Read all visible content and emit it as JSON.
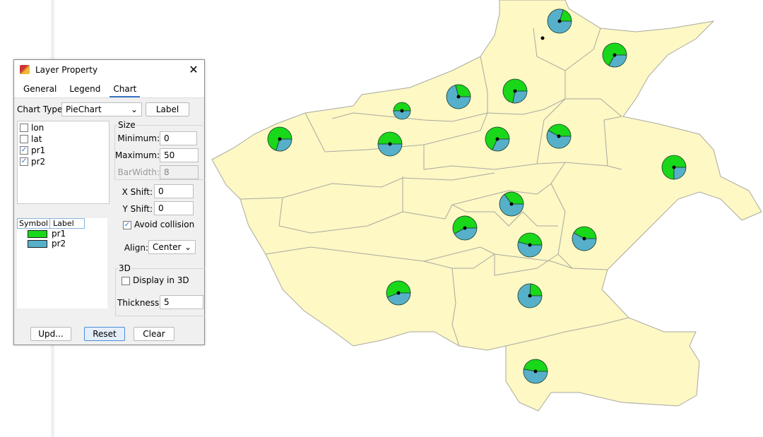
{
  "dialog": {
    "title": "Layer Property",
    "close_icon": "close-icon",
    "tabs": [
      {
        "label": "General"
      },
      {
        "label": "Legend"
      },
      {
        "label": "Chart",
        "active": true
      }
    ],
    "chart_type_label": "Chart Type:",
    "chart_type_value": "PieChart",
    "label_button": "Label",
    "fields": [
      {
        "name": "lon",
        "checked": false
      },
      {
        "name": "lat",
        "checked": false
      },
      {
        "name": "pr1",
        "checked": true
      },
      {
        "name": "pr2",
        "checked": true
      }
    ],
    "size_group": "Size",
    "minimum_label": "Minimum:",
    "minimum_value": "0",
    "maximum_label": "Maximum:",
    "maximum_value": "50",
    "barwidth_label": "BarWidth:",
    "barwidth_value": "8",
    "xshift_label": "X Shift:",
    "xshift_value": "0",
    "yshift_label": "Y Shift:",
    "yshift_value": "0",
    "avoid_collision_label": "Avoid collision",
    "avoid_collision": true,
    "align_label": "Align:",
    "align_value": "Center",
    "legend_headers": [
      "Symbol",
      "Label"
    ],
    "legend_items": [
      {
        "label": "pr1",
        "color": "#19d719"
      },
      {
        "label": "pr2",
        "color": "#56b0c9"
      }
    ],
    "group_3d": "3D",
    "display3d_label": "Display in 3D",
    "display3d": false,
    "thickness_label": "Thickness:",
    "thickness_value": "5",
    "buttons": {
      "update": "Upd...",
      "reset": "Reset",
      "clear": "Clear"
    }
  },
  "map": {
    "fill": "#fdf8c4",
    "border": "#a9a9a0",
    "pie_colors": {
      "pr1": "#19d719",
      "pr2": "#56b0c9"
    },
    "pies": [
      {
        "pr1": 20,
        "pr2": 80
      },
      {
        "pr1": 67,
        "pr2": 33
      },
      {
        "pr1": 72,
        "pr2": 28
      },
      {
        "pr1": 29,
        "pr2": 71
      },
      {
        "pr1": 25,
        "pr2": 25
      },
      {
        "pr1": 70,
        "pr2": 30
      },
      {
        "pr1": 50,
        "pr2": 50
      },
      {
        "pr1": 68,
        "pr2": 32
      },
      {
        "pr1": 42,
        "pr2": 58
      },
      {
        "pr1": 75,
        "pr2": 25
      },
      {
        "pr1": 35,
        "pr2": 65
      },
      {
        "pr1": 58,
        "pr2": 42
      },
      {
        "pr1": 46,
        "pr2": 54
      },
      {
        "pr1": 42,
        "pr2": 58
      },
      {
        "pr1": 56,
        "pr2": 44
      },
      {
        "pr1": 24,
        "pr2": 76
      },
      {
        "pr1": 47,
        "pr2": 53
      }
    ]
  }
}
